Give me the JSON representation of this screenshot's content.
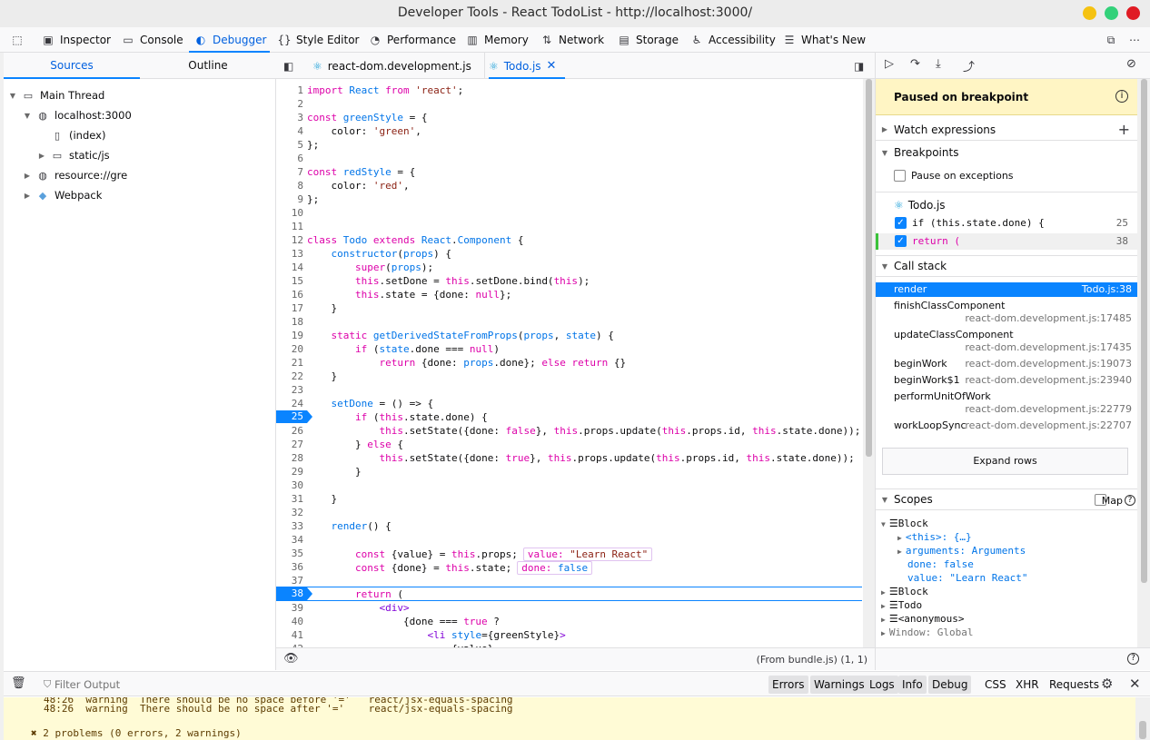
{
  "window": {
    "title": "Developer Tools - React TodoList - http://localhost:3000/"
  },
  "toolbar": {
    "tabs": [
      {
        "label": "Inspector",
        "icon": "inspector-icon"
      },
      {
        "label": "Console",
        "icon": "console-icon"
      },
      {
        "label": "Debugger",
        "icon": "debugger-icon",
        "selected": true
      },
      {
        "label": "Style Editor",
        "icon": "style-editor-icon"
      },
      {
        "label": "Performance",
        "icon": "performance-icon"
      },
      {
        "label": "Memory",
        "icon": "memory-icon"
      },
      {
        "label": "Network",
        "icon": "network-icon"
      },
      {
        "label": "Storage",
        "icon": "storage-icon"
      },
      {
        "label": "Accessibility",
        "icon": "accessibility-icon"
      },
      {
        "label": "What's New",
        "icon": "whats-new-icon"
      }
    ]
  },
  "sources": {
    "tabs": [
      "Sources",
      "Outline"
    ],
    "tree": [
      {
        "label": "Main Thread"
      },
      {
        "label": "localhost:3000"
      },
      {
        "label": "(index)"
      },
      {
        "label": "static/js"
      },
      {
        "label": "resource://gre"
      },
      {
        "label": "Webpack"
      }
    ]
  },
  "editor": {
    "tabs": [
      "react-dom.development.js",
      "Todo.js"
    ],
    "status": "(From bundle.js)  (1, 1)",
    "previews": {
      "value_key": "value:",
      "value_val": "\"Learn React\"",
      "done_key": "done:",
      "done_val": "false"
    }
  },
  "right": {
    "paused": "Paused on breakpoint",
    "watch": "Watch expressions",
    "breakpoints": "Breakpoints",
    "pause_exceptions": "Pause on exceptions",
    "bp_file": "Todo.js",
    "bp_items": [
      {
        "text": "if (this.state.done) {",
        "line": "25"
      },
      {
        "text": "return (",
        "line": "38"
      }
    ],
    "callstack": "Call stack",
    "frames": [
      {
        "fn": "render",
        "loc": "Todo.js:38"
      },
      {
        "fn": "finishClassComponent",
        "loc": "react-dom.development.js:17485"
      },
      {
        "fn": "updateClassComponent",
        "loc": "react-dom.development.js:17435"
      },
      {
        "fn": "beginWork",
        "loc": "react-dom.development.js:19073"
      },
      {
        "fn": "beginWork$1",
        "loc": "react-dom.development.js:23940"
      },
      {
        "fn": "performUnitOfWork",
        "loc": "react-dom.development.js:22779"
      },
      {
        "fn": "workLoopSync",
        "loc": "react-dom.development.js:22707"
      }
    ],
    "expand_rows": "Expand rows",
    "scopes": "Scopes",
    "map": "Map",
    "scope_items": [
      "☰Block",
      "<this>: {…}",
      "arguments: Arguments",
      "done: false",
      "value: \"Learn React\"",
      "☰Block",
      "☰Todo",
      "☰<anonymous>",
      "Window: Global"
    ]
  },
  "console": {
    "filter_placeholder": "Filter Output",
    "levels": [
      "Errors",
      "Warnings",
      "Logs",
      "Info",
      "Debug"
    ],
    "categories": [
      "CSS",
      "XHR",
      "Requests"
    ],
    "lines": [
      "48:26  warning  There should be no space before '='   react/jsx-equals-spacing",
      "48:26  warning  There should be no space after '='    react/jsx-equals-spacing",
      "✖ 2 problems (0 errors, 2 warnings)"
    ]
  }
}
